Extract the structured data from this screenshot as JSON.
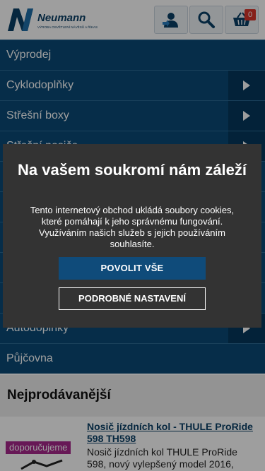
{
  "header": {
    "brand_name": "Neumann",
    "brand_tagline": "VÝROBA OSVĚTLENÍ NÁVĚSŮ A ŘÍKAS",
    "cart_count": "0"
  },
  "menu": {
    "items": [
      {
        "label": "Výprodej",
        "has_arrow": false
      },
      {
        "label": "Cyklodoplňky",
        "has_arrow": true
      },
      {
        "label": "Střešní boxy",
        "has_arrow": true
      },
      {
        "label": "Střešní nosiče",
        "has_arrow": true
      },
      {
        "label": "",
        "has_arrow": false
      },
      {
        "label": "",
        "has_arrow": false
      },
      {
        "label": "",
        "has_arrow": false
      },
      {
        "label": "",
        "has_arrow": false
      },
      {
        "label": "",
        "has_arrow": false
      },
      {
        "label": "Autodoplňky",
        "has_arrow": true
      },
      {
        "label": "Půjčovna",
        "has_arrow": false
      }
    ]
  },
  "cookie": {
    "title": "Na vašem soukromí nám záleží",
    "text": "Tento internetový obchod ukládá soubory cookies, které pomáhají k jeho správnému fungování. Využíváním našich služeb s jejich používáním souhlasíte.",
    "allow_label": "POVOLIT VŠE",
    "settings_label": "PODROBNÉ NASTAVENÍ"
  },
  "bestsellers": {
    "title": "Nejprodávanější",
    "product": {
      "name": "Nosič jízdních kol - THULE ProRide 598 TH598",
      "badge": "doporučujeme",
      "description": "Nosič jízdních kol THULE ProRide 598, nový vylepšený model 2016,"
    }
  },
  "colors": {
    "menu_bg": "#0a4a76",
    "arrow_bg": "#06385c",
    "modal_bg": "#333333",
    "allow_btn": "#0f4b7a",
    "badge": "#a6278c",
    "cart_badge": "#d9342b"
  }
}
